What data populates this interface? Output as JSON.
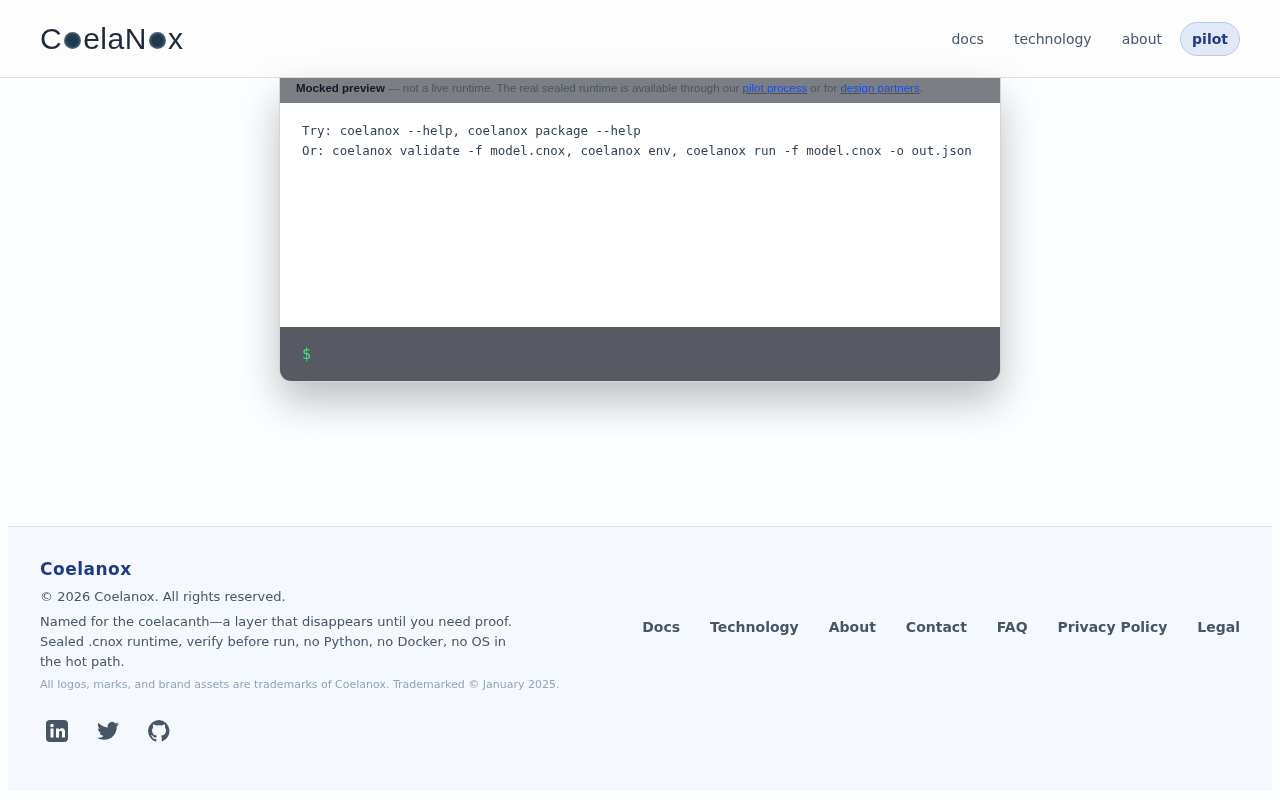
{
  "header": {
    "logo_parts": [
      "C",
      "elaN",
      "x"
    ],
    "nav": [
      {
        "label": "docs",
        "selected": false
      },
      {
        "label": "technology",
        "selected": false
      },
      {
        "label": "about",
        "selected": false
      },
      {
        "label": "pilot",
        "selected": true
      }
    ]
  },
  "terminal": {
    "notice": {
      "lead": "Mocked preview",
      "text": " — not a live runtime. The real sealed runtime is available through our ",
      "link_1": "pilot process",
      "middle": " or for ",
      "link_2": "design partners",
      "end": "."
    },
    "lines": [
      "Try: coelanox --help, coelanox package --help",
      "Or: coelanox validate -f model.cnox, coelanox env, coelanox run -f model.cnox -o out.json"
    ],
    "prompt": "$"
  },
  "footer": {
    "brand": "Coelanox",
    "copyright": "© 2026 Coelanox. All rights reserved.",
    "description": "Named for the coelacanth—a layer that disappears until you need proof. Sealed .cnox runtime, verify before run, no Python, no Docker, no OS in the hot path.",
    "trademark": "All logos, marks, and brand assets are trademarks of Coelanox. Trademarked © January 2025.",
    "links": [
      "Docs",
      "Technology",
      "About",
      "Contact",
      "FAQ",
      "Privacy Policy",
      "Legal"
    ],
    "social": [
      {
        "kind": "linkedin"
      },
      {
        "kind": "twitter"
      },
      {
        "kind": "github"
      }
    ]
  }
}
